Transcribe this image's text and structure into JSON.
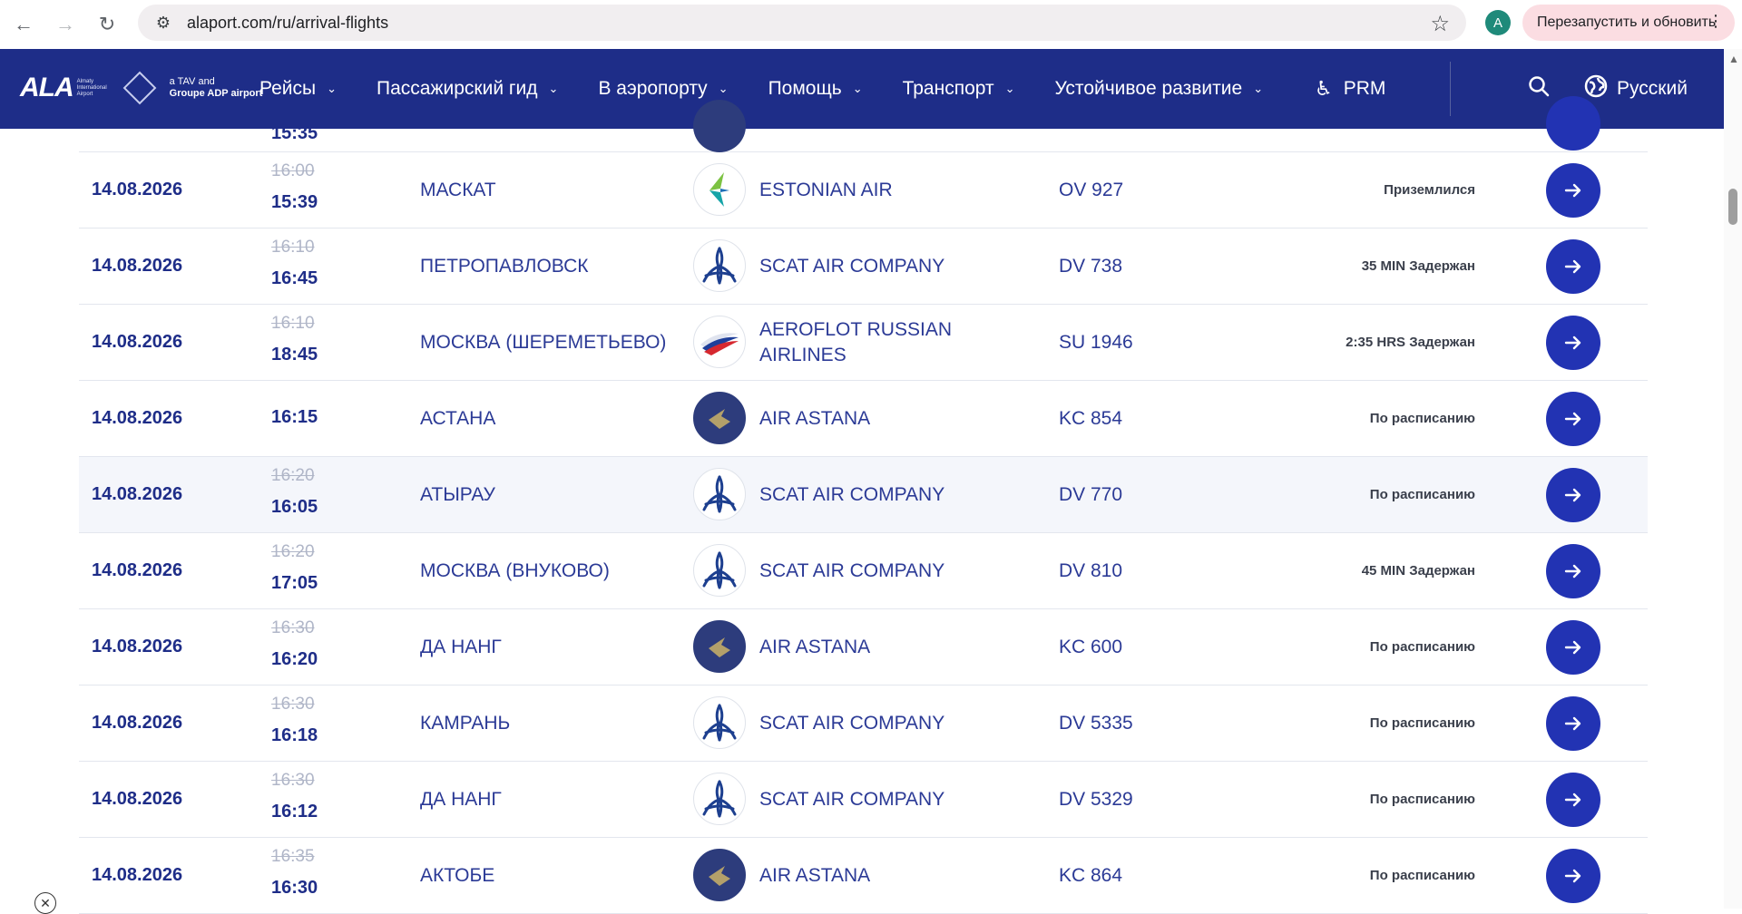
{
  "browser": {
    "url": "alaport.com/ru/arrival-flights",
    "profile_initial": "A",
    "relaunch_label": "Перезапустить и обновить"
  },
  "header": {
    "logo_text": "ALA",
    "logo_sub": "Almaty International Airport",
    "logo_partner_line1": "a TAV and",
    "logo_partner_line2": "Groupe ADP airport",
    "menu": [
      {
        "label": "Рейсы"
      },
      {
        "label": "Пассажирский гид"
      },
      {
        "label": "В аэропорту"
      },
      {
        "label": "Помощь"
      },
      {
        "label": "Транспорт"
      },
      {
        "label": "Устойчивое развитие"
      }
    ],
    "prm_label": "PRM",
    "language": "Русский"
  },
  "partial_row": {
    "time": "15:35"
  },
  "flights": [
    {
      "date": "14.08.2026",
      "scheduled": "16:00",
      "actual": "15:39",
      "city": "МАСКАТ",
      "airline": "ESTONIAN AIR",
      "logo": "estonian",
      "flight": "OV 927",
      "status": "Приземлился"
    },
    {
      "date": "14.08.2026",
      "scheduled": "16:10",
      "actual": "16:45",
      "city": "ПЕТРОПАВЛОВСК",
      "airline": "SCAT AIR COMPANY",
      "logo": "scat",
      "flight": "DV 738",
      "status": "35 MIN Задержан"
    },
    {
      "date": "14.08.2026",
      "scheduled": "16:10",
      "actual": "18:45",
      "city": "МОСКВА (ШЕРЕМЕТЬЕВО)",
      "airline": "AEROFLOT RUSSIAN AIRLINES",
      "logo": "aeroflot",
      "flight": "SU 1946",
      "status": "2:35 HRS Задержан"
    },
    {
      "date": "14.08.2026",
      "scheduled": "",
      "actual": "16:15",
      "city": "АСТАНА",
      "airline": "AIR ASTANA",
      "logo": "astana",
      "flight": "KC 854",
      "status": "По расписанию"
    },
    {
      "date": "14.08.2026",
      "scheduled": "16:20",
      "actual": "16:05",
      "city": "АТЫРАУ",
      "airline": "SCAT AIR COMPANY",
      "logo": "scat",
      "flight": "DV 770",
      "status": "По расписанию"
    },
    {
      "date": "14.08.2026",
      "scheduled": "16:20",
      "actual": "17:05",
      "city": "МОСКВА (ВНУКОВО)",
      "airline": "SCAT AIR COMPANY",
      "logo": "scat",
      "flight": "DV 810",
      "status": "45 MIN Задержан"
    },
    {
      "date": "14.08.2026",
      "scheduled": "16:30",
      "actual": "16:20",
      "city": "ДА НАНГ",
      "airline": "AIR ASTANA",
      "logo": "astana",
      "flight": "KC 600",
      "status": "По расписанию"
    },
    {
      "date": "14.08.2026",
      "scheduled": "16:30",
      "actual": "16:18",
      "city": "КАМРАНЬ",
      "airline": "SCAT AIR COMPANY",
      "logo": "scat",
      "flight": "DV 5335",
      "status": "По расписанию"
    },
    {
      "date": "14.08.2026",
      "scheduled": "16:30",
      "actual": "16:12",
      "city": "ДА НАНГ",
      "airline": "SCAT AIR COMPANY",
      "logo": "scat",
      "flight": "DV 5329",
      "status": "По расписанию"
    },
    {
      "date": "14.08.2026",
      "scheduled": "16:35",
      "actual": "16:30",
      "city": "АКТОБЕ",
      "airline": "AIR ASTANA",
      "logo": "astana",
      "flight": "KC 864",
      "status": "По расписанию"
    }
  ],
  "highlighted_row": 4,
  "colors": {
    "header": "#1e2d88",
    "action": "#2233b3",
    "text": "#2b3a96"
  }
}
